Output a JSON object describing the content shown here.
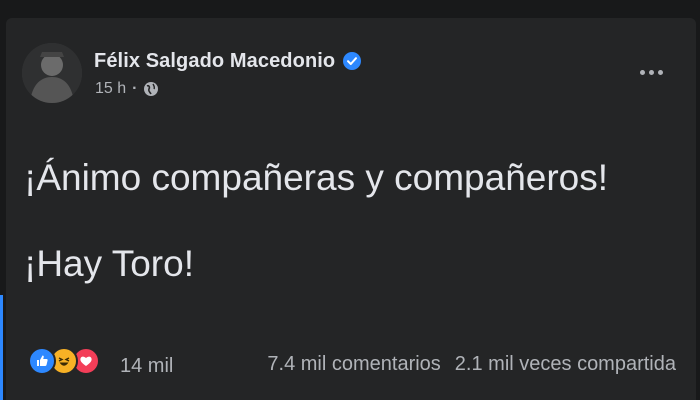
{
  "post": {
    "author": "Félix Salgado Macedonio",
    "time": "15 h",
    "privacy_icon": "globe-icon",
    "lines": [
      "¡Ánimo compañeras y compañeros!",
      "¡Hay Toro!"
    ]
  },
  "engagement": {
    "reaction_icons": [
      "like-icon",
      "haha-icon",
      "love-icon"
    ],
    "reaction_count": "14 mil",
    "comments": "7.4 mil comentarios",
    "shares": "2.1 mil veces compartida"
  },
  "colors": {
    "background": "#18191a",
    "card": "#242526",
    "text": "#e4e6eb",
    "muted": "#b0b3b8",
    "accent_blue": "#2d88ff",
    "haha_yellow": "#f7b125",
    "love_red": "#f33e58"
  }
}
